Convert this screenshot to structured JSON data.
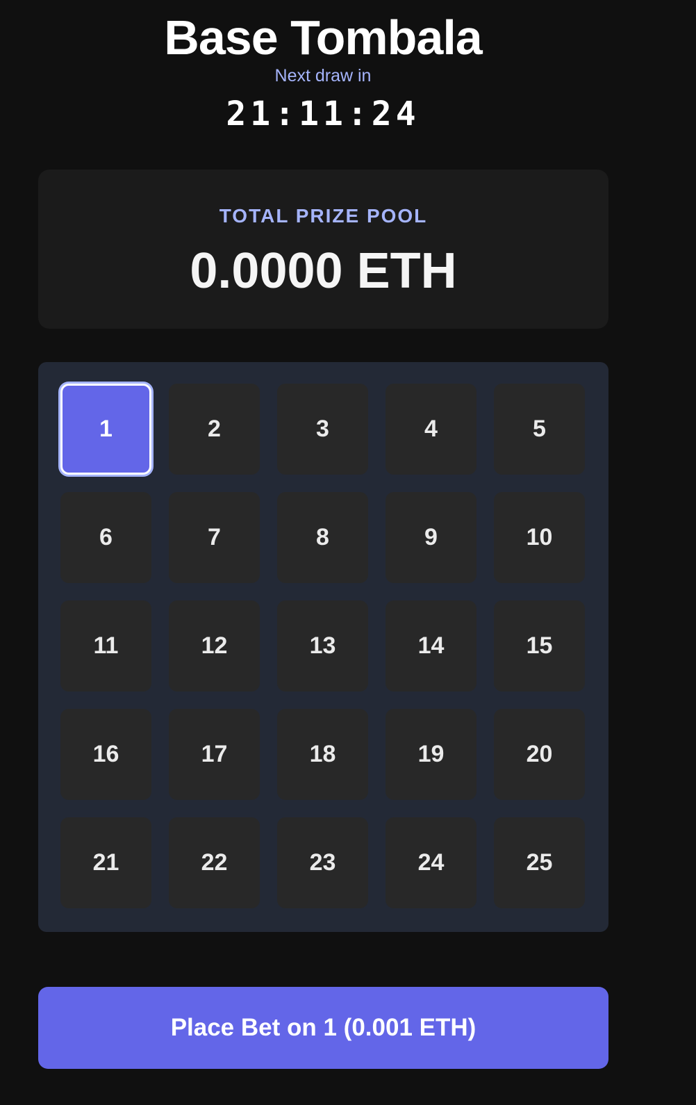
{
  "header": {
    "title": "Base Tombala",
    "next_draw_label": "Next draw in",
    "countdown": "21:11:24"
  },
  "prize_pool": {
    "label": "TOTAL PRIZE POOL",
    "value": "0.0000 ETH"
  },
  "number_grid": {
    "selected": "1",
    "numbers": [
      "1",
      "2",
      "3",
      "4",
      "5",
      "6",
      "7",
      "8",
      "9",
      "10",
      "11",
      "12",
      "13",
      "14",
      "15",
      "16",
      "17",
      "18",
      "19",
      "20",
      "21",
      "22",
      "23",
      "24",
      "25"
    ]
  },
  "bet_button": {
    "label": "Place Bet on 1 (0.001 ETH)"
  },
  "colors": {
    "background": "#101010",
    "accent": "#6366e8",
    "label_lavender": "#a5b4fc",
    "card": "#1b1b1b",
    "grid_panel": "#232936",
    "cell": "#282828"
  }
}
